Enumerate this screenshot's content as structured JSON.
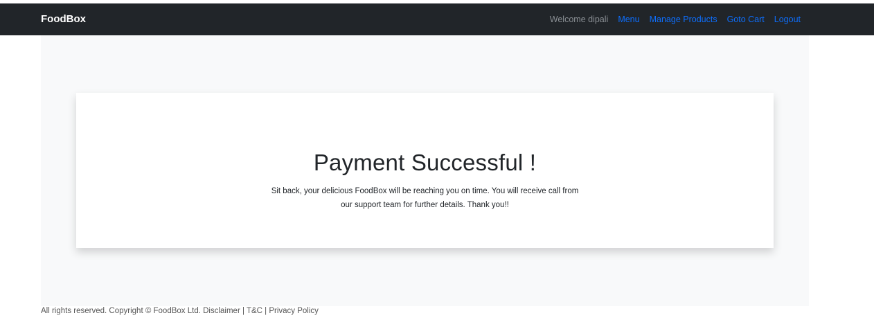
{
  "navbar": {
    "brand": "FoodBox",
    "welcome": "Welcome dipali",
    "links": {
      "menu": "Menu",
      "manage_products": "Manage Products",
      "goto_cart": "Goto Cart",
      "logout": "Logout"
    }
  },
  "card": {
    "title": "Payment Successful !",
    "message": "Sit back, your delicious FoodBox will be reaching you on time. You will receive call from our support team for further details. Thank you!!"
  },
  "footer": {
    "text": "All rights reserved. Copyright © FoodBox Ltd. Disclaimer | T&C | Privacy Policy"
  },
  "colors": {
    "navbar_bg": "#212529",
    "link": "#0d6efd",
    "content_bg": "#f8f9fa"
  }
}
